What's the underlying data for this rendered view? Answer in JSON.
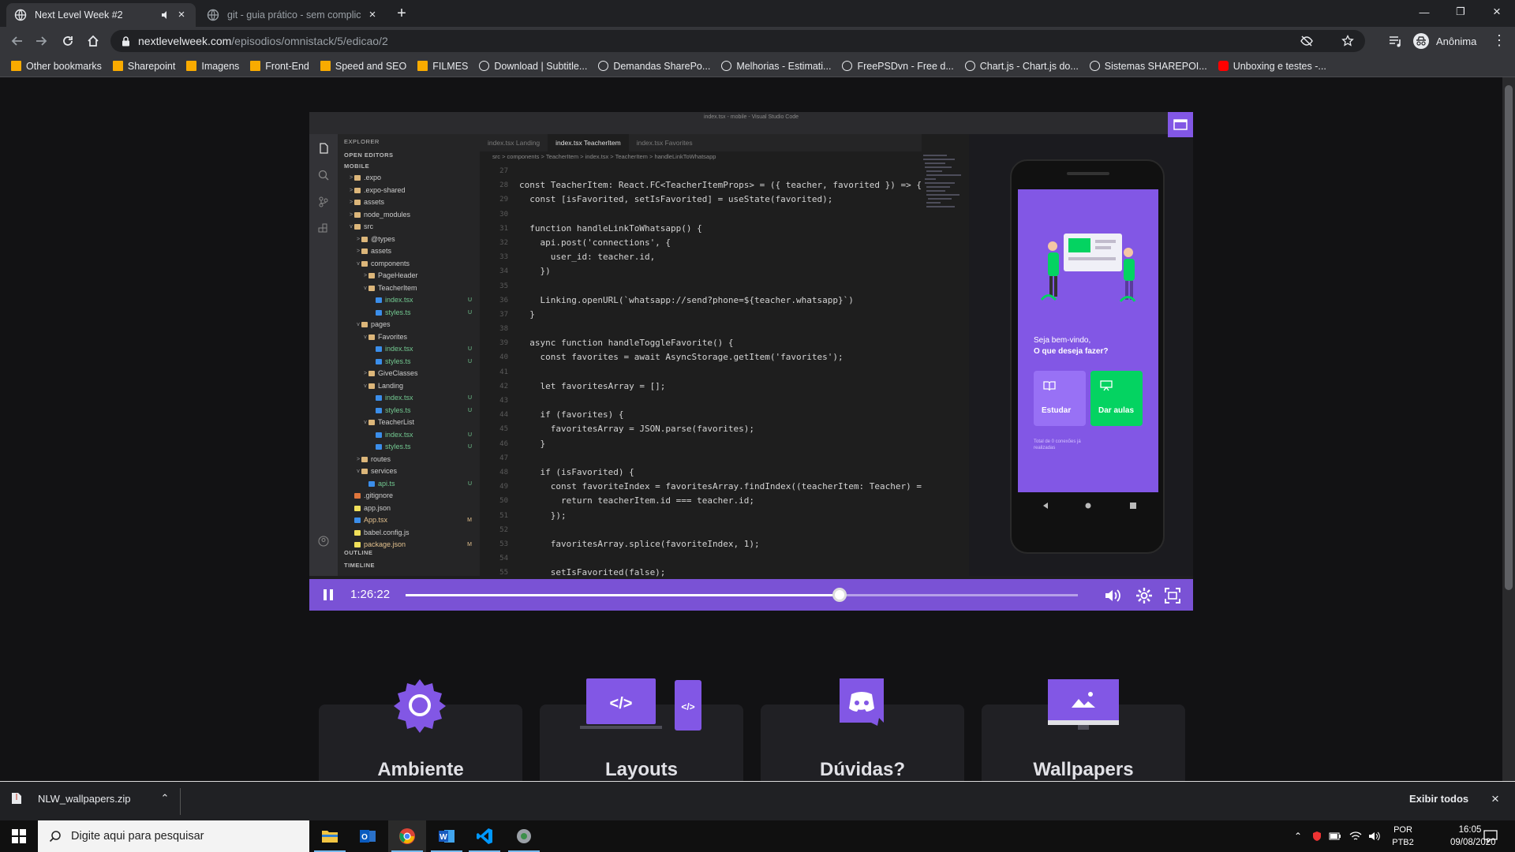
{
  "browser": {
    "tabs": [
      {
        "title": "Next Level Week #2",
        "active": true
      },
      {
        "title": "git - guia prático - sem complica",
        "active": false
      }
    ],
    "url_host": "nextlevelweek.com",
    "url_path": "/episodios/omnistack/5/edicao/2",
    "profile_label": "Anônima",
    "bookmarks": [
      "Other bookmarks",
      "Sharepoint",
      "Imagens",
      "Front-End",
      "Speed and SEO",
      "FILMES",
      "Download | Subtitle...",
      "Demandas SharePo...",
      "Melhorias - Estimati...",
      "FreePSDvn - Free d...",
      "Chart.js - Chart.js do...",
      "Sistemas SHAREPOI...",
      "Unboxing e testes -..."
    ],
    "bookmark_icons": [
      "folder",
      "folder",
      "folder",
      "folder",
      "folder",
      "folder",
      "globe",
      "globe",
      "globe",
      "globe",
      "globe",
      "globe",
      "youtube"
    ]
  },
  "video": {
    "window_title": "index.tsx - mobile - Visual Studio Code",
    "explorer_label": "EXPLORER",
    "open_editors_label": "OPEN EDITORS",
    "project_label": "MOBILE",
    "outline_label": "OUTLINE",
    "timeline_label": "TIMELINE",
    "tree": [
      {
        "name": ".expo",
        "indent": 1,
        "type": "f",
        "caret": ">"
      },
      {
        "name": ".expo-shared",
        "indent": 1,
        "type": "f",
        "caret": ">"
      },
      {
        "name": "assets",
        "indent": 1,
        "type": "f",
        "caret": ">"
      },
      {
        "name": "node_modules",
        "indent": 1,
        "type": "f",
        "caret": ">"
      },
      {
        "name": "src",
        "indent": 1,
        "type": "f",
        "caret": "v"
      },
      {
        "name": "@types",
        "indent": 2,
        "type": "f",
        "caret": ">"
      },
      {
        "name": "assets",
        "indent": 2,
        "type": "f",
        "caret": ">"
      },
      {
        "name": "components",
        "indent": 2,
        "type": "f",
        "caret": "v"
      },
      {
        "name": "PageHeader",
        "indent": 3,
        "type": "f",
        "caret": ">"
      },
      {
        "name": "TeacherItem",
        "indent": 3,
        "type": "f",
        "caret": "v"
      },
      {
        "name": "index.tsx",
        "indent": 4,
        "type": "t",
        "caret": "",
        "badge": "U"
      },
      {
        "name": "styles.ts",
        "indent": 4,
        "type": "t",
        "caret": "",
        "badge": "U"
      },
      {
        "name": "pages",
        "indent": 2,
        "type": "f",
        "caret": "v"
      },
      {
        "name": "Favorites",
        "indent": 3,
        "type": "f",
        "caret": "v"
      },
      {
        "name": "index.tsx",
        "indent": 4,
        "type": "t",
        "caret": "",
        "badge": "U"
      },
      {
        "name": "styles.ts",
        "indent": 4,
        "type": "t",
        "caret": "",
        "badge": "U"
      },
      {
        "name": "GiveClasses",
        "indent": 3,
        "type": "f",
        "caret": ">"
      },
      {
        "name": "Landing",
        "indent": 3,
        "type": "f",
        "caret": "v"
      },
      {
        "name": "index.tsx",
        "indent": 4,
        "type": "t",
        "caret": "",
        "badge": "U"
      },
      {
        "name": "styles.ts",
        "indent": 4,
        "type": "t",
        "caret": "",
        "badge": "U"
      },
      {
        "name": "TeacherList",
        "indent": 3,
        "type": "f",
        "caret": "v"
      },
      {
        "name": "index.tsx",
        "indent": 4,
        "type": "t",
        "caret": "",
        "badge": "U"
      },
      {
        "name": "styles.ts",
        "indent": 4,
        "type": "t",
        "caret": "",
        "badge": "U"
      },
      {
        "name": "routes",
        "indent": 2,
        "type": "f",
        "caret": ">"
      },
      {
        "name": "services",
        "indent": 2,
        "type": "f",
        "caret": "v"
      },
      {
        "name": "api.ts",
        "indent": 3,
        "type": "t",
        "caret": "",
        "badge": "U"
      },
      {
        "name": ".gitignore",
        "indent": 1,
        "type": "g",
        "caret": ""
      },
      {
        "name": "app.json",
        "indent": 1,
        "type": "j",
        "caret": ""
      },
      {
        "name": "App.tsx",
        "indent": 1,
        "type": "t",
        "caret": "",
        "badge": "M"
      },
      {
        "name": "babel.config.js",
        "indent": 1,
        "type": "j",
        "caret": ""
      },
      {
        "name": "package.json",
        "indent": 1,
        "type": "j",
        "caret": "",
        "badge": "M"
      }
    ],
    "editor_tabs": [
      "index.tsx Landing",
      "index.tsx TeacherItem",
      "index.tsx Favorites"
    ],
    "active_editor_tab": 1,
    "breadcrumb": "src > components > TeacherItem > index.tsx > TeacherItem > handleLinkToWhatsapp",
    "code": [
      {
        "n": "27",
        "t": ""
      },
      {
        "n": "28",
        "t": "const TeacherItem: React.FC<TeacherItemProps> = ({ teacher, favorited }) => {"
      },
      {
        "n": "29",
        "t": "  const [isFavorited, setIsFavorited] = useState(favorited);"
      },
      {
        "n": "30",
        "t": ""
      },
      {
        "n": "31",
        "t": "  function handleLinkToWhatsapp() {"
      },
      {
        "n": "32",
        "t": "    api.post('connections', {"
      },
      {
        "n": "33",
        "t": "      user_id: teacher.id,"
      },
      {
        "n": "34",
        "t": "    })"
      },
      {
        "n": "35",
        "t": ""
      },
      {
        "n": "36",
        "t": "    Linking.openURL(`whatsapp://send?phone=${teacher.whatsapp}`)"
      },
      {
        "n": "37",
        "t": "  }"
      },
      {
        "n": "38",
        "t": ""
      },
      {
        "n": "39",
        "t": "  async function handleToggleFavorite() {"
      },
      {
        "n": "40",
        "t": "    const favorites = await AsyncStorage.getItem('favorites');"
      },
      {
        "n": "41",
        "t": ""
      },
      {
        "n": "42",
        "t": "    let favoritesArray = [];"
      },
      {
        "n": "43",
        "t": ""
      },
      {
        "n": "44",
        "t": "    if (favorites) {"
      },
      {
        "n": "45",
        "t": "      favoritesArray = JSON.parse(favorites);"
      },
      {
        "n": "46",
        "t": "    }"
      },
      {
        "n": "47",
        "t": ""
      },
      {
        "n": "48",
        "t": "    if (isFavorited) {"
      },
      {
        "n": "49",
        "t": "      const favoriteIndex = favoritesArray.findIndex((teacherItem: Teacher) ="
      },
      {
        "n": "50",
        "t": "        return teacherItem.id === teacher.id;"
      },
      {
        "n": "51",
        "t": "      });"
      },
      {
        "n": "52",
        "t": ""
      },
      {
        "n": "53",
        "t": "      favoritesArray.splice(favoriteIndex, 1);"
      },
      {
        "n": "54",
        "t": ""
      },
      {
        "n": "55",
        "t": "      setIsFavorited(false);"
      }
    ],
    "phone": {
      "welcome_line1": "Seja bem-vindo,",
      "welcome_line2": "O que deseja fazer?",
      "study_label": "Estudar",
      "teach_label": "Dar aulas",
      "connections_text": "Total de 0 conexões já realizadas"
    },
    "player": {
      "time": "1:26:22",
      "progress": 0.645
    },
    "colors": {
      "accent": "#8257e5",
      "green": "#04d361"
    }
  },
  "cards": [
    {
      "title": "Ambiente",
      "icon": "gear-icon"
    },
    {
      "title": "Layouts",
      "icon": "code-layout-icon"
    },
    {
      "title": "Dúvidas?",
      "icon": "discord-icon"
    },
    {
      "title": "Wallpapers",
      "icon": "image-monitor-icon"
    }
  ],
  "download": {
    "filename": "NLW_wallpapers.zip",
    "show_all": "Exibir todos"
  },
  "taskbar": {
    "search_placeholder": "Digite aqui para pesquisar",
    "lang_line1": "POR",
    "lang_line2": "PTB2",
    "time": "16:05",
    "date": "09/08/2020"
  }
}
